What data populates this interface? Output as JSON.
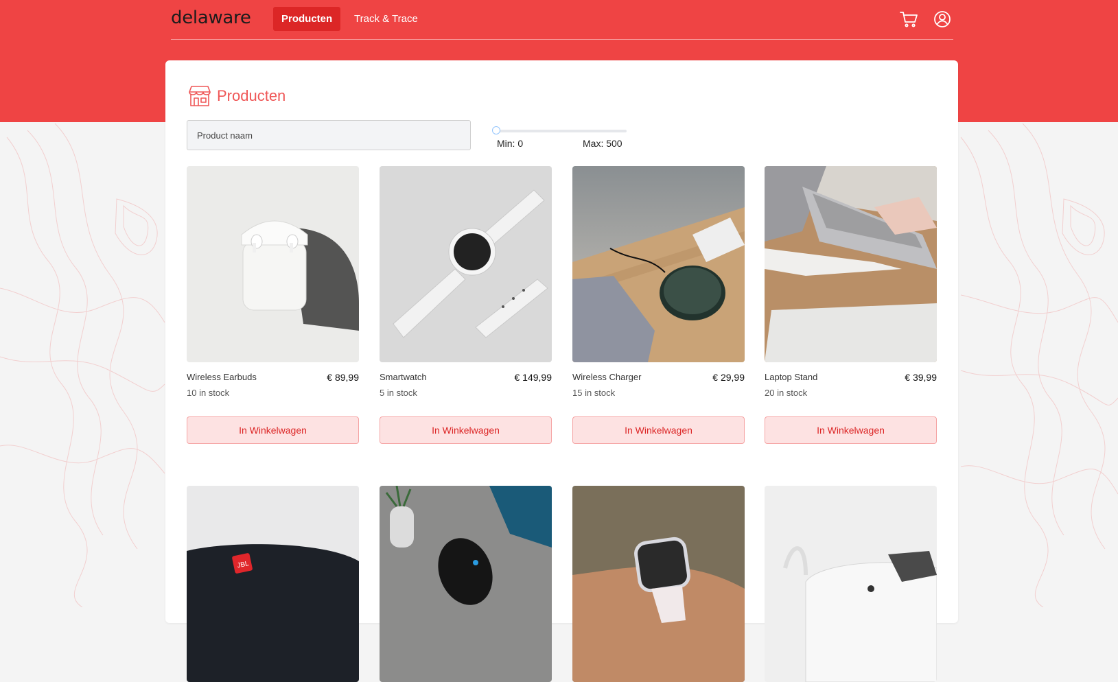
{
  "header": {
    "brand": "delaware",
    "nav": [
      {
        "label": "Producten",
        "active": true
      },
      {
        "label": "Track & Trace",
        "active": false
      }
    ],
    "icons": [
      "cart-icon",
      "user-icon"
    ]
  },
  "colors": {
    "accent": "#ef4444",
    "accent_dark": "#dc2626",
    "button_bg": "#fde2e2"
  },
  "page": {
    "title": "Producten",
    "title_icon": "store-icon"
  },
  "filters": {
    "search_placeholder": "Product naam",
    "min_label": "Min: 0",
    "max_label": "Max: 500"
  },
  "products": [
    {
      "name": "Wireless Earbuds",
      "price": "€ 89,99",
      "stock": "10 in stock",
      "button": "In Winkelwagen"
    },
    {
      "name": "Smartwatch",
      "price": "€ 149,99",
      "stock": "5 in stock",
      "button": "In Winkelwagen"
    },
    {
      "name": "Wireless Charger",
      "price": "€ 29,99",
      "stock": "15 in stock",
      "button": "In Winkelwagen"
    },
    {
      "name": "Laptop Stand",
      "price": "€ 39,99",
      "stock": "20 in stock",
      "button": "In Winkelwagen"
    }
  ]
}
